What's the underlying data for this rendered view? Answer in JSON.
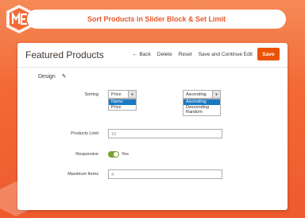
{
  "banner": {
    "title": "Sort Products in Slider Block & Set Limit"
  },
  "colors": {
    "brand_orange": "#f36a36",
    "save_button": "#eb5202",
    "selected_option": "#1979c3",
    "toggle_on": "#79a22e"
  },
  "header": {
    "title": "Featured Products",
    "back_label": "Back",
    "delete_label": "Delete",
    "reset_label": "Reset",
    "save_continue_label": "Save and Continue Edit",
    "save_label": "Save"
  },
  "section": {
    "title": "Design"
  },
  "form": {
    "sorting": {
      "label": "Sorting",
      "field_value": "Price",
      "field_options": [
        "Name",
        "Price"
      ],
      "field_selected": "Name",
      "order_value": "Ascending",
      "order_options": [
        "Ascending",
        "Descending",
        "Random"
      ],
      "order_selected": "Ascending"
    },
    "products_limit": {
      "label": "Products Limit",
      "value": "10"
    },
    "responsive": {
      "label": "Responsive",
      "value_label": "Yes",
      "enabled": true
    },
    "maximum_items": {
      "label": "Maximum Items",
      "value": "4"
    }
  },
  "icons": {
    "logo": "me-logo",
    "back": "arrow-left-icon",
    "edit": "pencil-icon",
    "dropdown": "chevron-down-icon"
  }
}
